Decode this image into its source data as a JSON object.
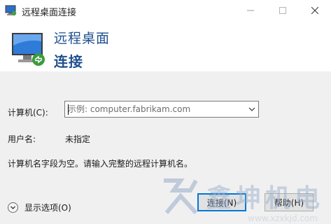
{
  "window": {
    "title": "远程桌面连接"
  },
  "banner": {
    "line1": "远程桌面",
    "line2": "连接"
  },
  "form": {
    "computer_label": "计算机(C):",
    "computer_placeholder": "示例: computer.fabrikam.com",
    "computer_value": "",
    "user_label": "用户名:",
    "user_value": "未指定",
    "message": "计算机名字段为空。请输入完整的远程计算机名。"
  },
  "footer": {
    "show_options_label": "显示选项(O)",
    "connect_label": "连接(N)",
    "help_label": "帮助(H)"
  },
  "watermark": {
    "brand": "鑫坤机电",
    "url": "www.xzxkjd.com"
  },
  "colors": {
    "accent": "#0078d7",
    "banner_text": "#1f4f8f",
    "background": "#f0f0f0"
  }
}
